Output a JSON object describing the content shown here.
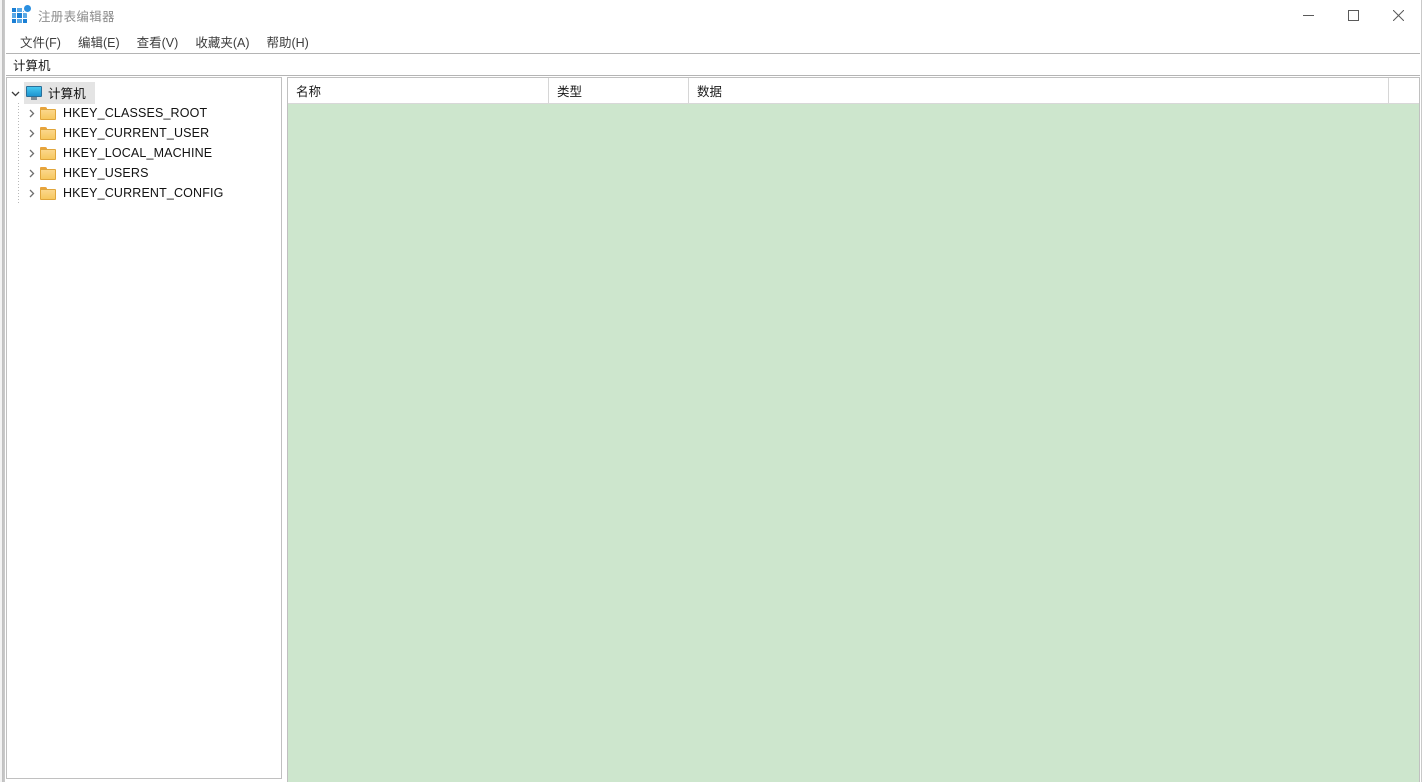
{
  "window": {
    "title": "注册表编辑器",
    "icon": "registry-editor-icon",
    "controls": {
      "minimize": "minimize-icon",
      "maximize": "maximize-icon",
      "close": "close-icon"
    }
  },
  "menu": {
    "items": [
      {
        "label": "文件(F)"
      },
      {
        "label": "编辑(E)"
      },
      {
        "label": "查看(V)"
      },
      {
        "label": "收藏夹(A)"
      },
      {
        "label": "帮助(H)"
      }
    ]
  },
  "address": {
    "value": "计算机",
    "placeholder": "计算机"
  },
  "tree": {
    "root": {
      "label": "计算机",
      "icon": "monitor-icon",
      "expanded": true,
      "selected": true
    },
    "children": [
      {
        "label": "HKEY_CLASSES_ROOT",
        "icon": "folder-icon",
        "expanded": false
      },
      {
        "label": "HKEY_CURRENT_USER",
        "icon": "folder-icon",
        "expanded": false
      },
      {
        "label": "HKEY_LOCAL_MACHINE",
        "icon": "folder-icon",
        "expanded": false
      },
      {
        "label": "HKEY_USERS",
        "icon": "folder-icon",
        "expanded": false
      },
      {
        "label": "HKEY_CURRENT_CONFIG",
        "icon": "folder-icon",
        "expanded": false
      }
    ]
  },
  "list": {
    "columns": [
      {
        "label": "名称"
      },
      {
        "label": "类型"
      },
      {
        "label": "数据"
      },
      {
        "label": ""
      }
    ],
    "rows": [],
    "background_color": "#cde6cd"
  },
  "colors": {
    "list_background": "#cde6cd",
    "selection": "#e4e4e4",
    "title_text": "#8d8d8d",
    "folder": "#f6c75f",
    "monitor": "#1e95d0",
    "app_icon": "#1b7fd4"
  }
}
